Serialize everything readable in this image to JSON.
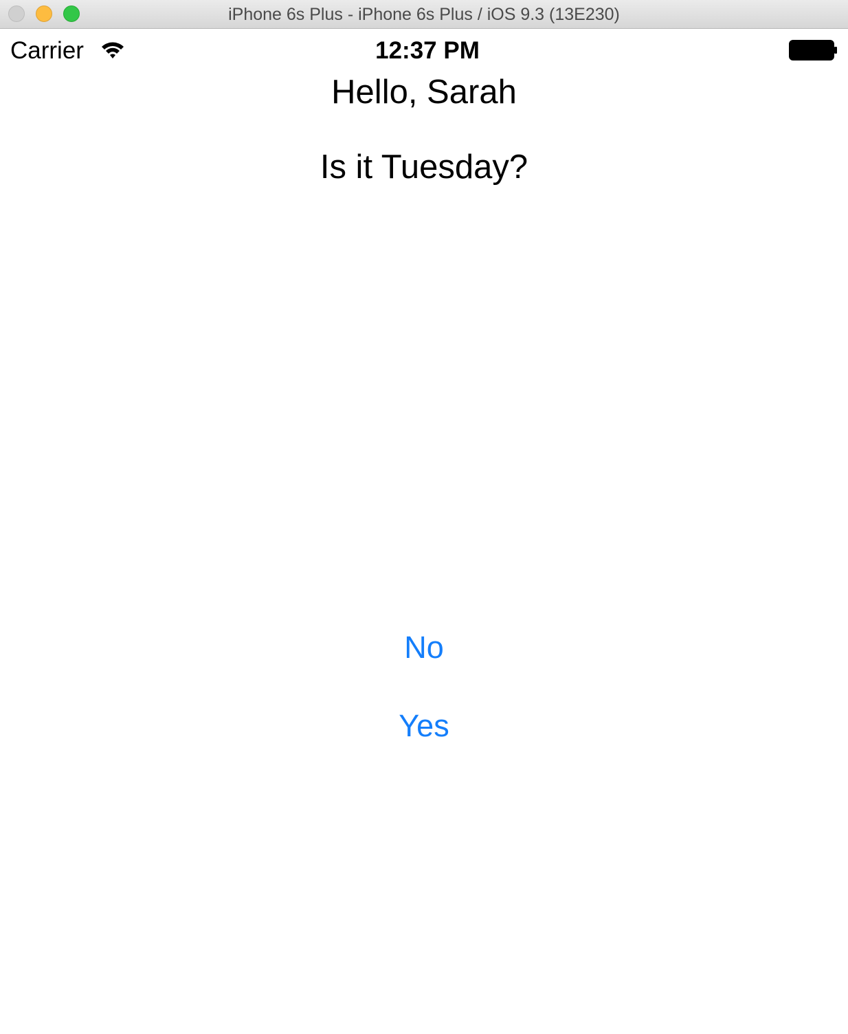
{
  "window": {
    "title": "iPhone 6s Plus - iPhone 6s Plus / iOS 9.3 (13E230)"
  },
  "status_bar": {
    "carrier": "Carrier",
    "time": "12:37 PM"
  },
  "screen": {
    "greeting": "Hello, Sarah",
    "question": "Is it Tuesday?",
    "buttons": {
      "no": "No",
      "yes": "Yes"
    }
  },
  "colors": {
    "tint": "#147efb",
    "text": "#000000",
    "background": "#ffffff"
  }
}
